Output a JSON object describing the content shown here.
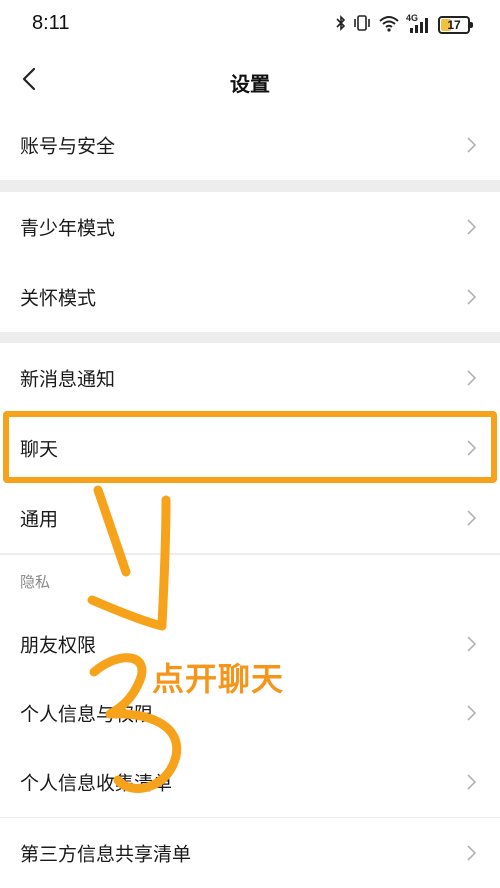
{
  "status_bar": {
    "time": "8:11",
    "battery": "17",
    "network": "4G",
    "battery_level": 0.17
  },
  "nav": {
    "title": "设置"
  },
  "menu": {
    "account_security": "账号与安全",
    "teen_mode": "青少年模式",
    "care_mode": "关怀模式",
    "notifications": "新消息通知",
    "chat": "聊天",
    "general": "通用",
    "privacy_header": "隐私",
    "friend_permissions": "朋友权限",
    "personal_info_permissions": "个人信息与权限",
    "personal_info_collection": "个人信息收集清单",
    "third_party_sharing": "第三方信息共享清单"
  },
  "annotation": {
    "text": "点开聊天",
    "color": "#f5961a"
  }
}
